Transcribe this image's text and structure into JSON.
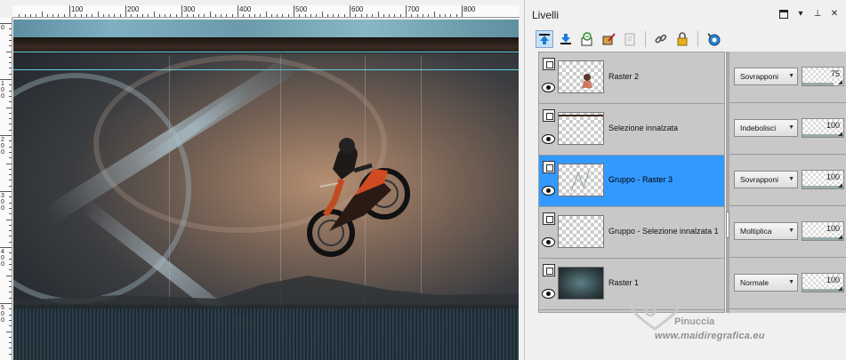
{
  "panel": {
    "title": "Livelli"
  },
  "toolbar": {
    "tools": [
      {
        "name": "move-layer-up-icon",
        "selected": true
      },
      {
        "name": "move-layer-down-icon",
        "selected": false
      },
      {
        "name": "layer-properties-icon",
        "selected": false
      },
      {
        "name": "edit-selection-icon",
        "selected": false
      },
      {
        "name": "delete-layer-icon",
        "selected": false
      },
      {
        "name": "link-icon",
        "selected": false
      },
      {
        "name": "lock-icon",
        "selected": false
      },
      {
        "name": "mask-icon",
        "selected": false
      }
    ]
  },
  "ruler": {
    "top_labels": [
      "100",
      "200",
      "300",
      "400",
      "500",
      "600",
      "700",
      "800"
    ],
    "left_labels": [
      "0",
      "1 0 0",
      "2 0 0",
      "3 0 0",
      "4 0 0",
      "5 0 0"
    ]
  },
  "layers": [
    {
      "name": "Raster 2",
      "blend": "Sovrapponi",
      "opacity": "75",
      "opacity_level": 0.75,
      "active": false,
      "thumb": "transparent-with-figure"
    },
    {
      "name": "Selezione innalzata",
      "blend": "Indebolisci",
      "opacity": "100",
      "opacity_level": 1.0,
      "active": false,
      "thumb": "transparent-with-line"
    },
    {
      "name": "Gruppo - Raster 3",
      "blend": "Sovrapponi",
      "opacity": "100",
      "opacity_level": 1.0,
      "active": true,
      "thumb": "transparent-with-sketch"
    },
    {
      "name": "Gruppo - Selezione innalzata 1",
      "blend": "Moltiplica",
      "opacity": "100",
      "opacity_level": 1.0,
      "active": false,
      "thumb": "transparent"
    },
    {
      "name": "Raster 1",
      "blend": "Normale",
      "opacity": "100",
      "opacity_level": 1.0,
      "active": false,
      "thumb": "image"
    }
  ],
  "watermark": {
    "name": "Pinuccia",
    "url": "www.maidiregrafica.eu"
  },
  "colors": {
    "active_layer": "#3399ff",
    "panel_bg": "#c8c8c8",
    "guide": "#5fd0e6"
  }
}
